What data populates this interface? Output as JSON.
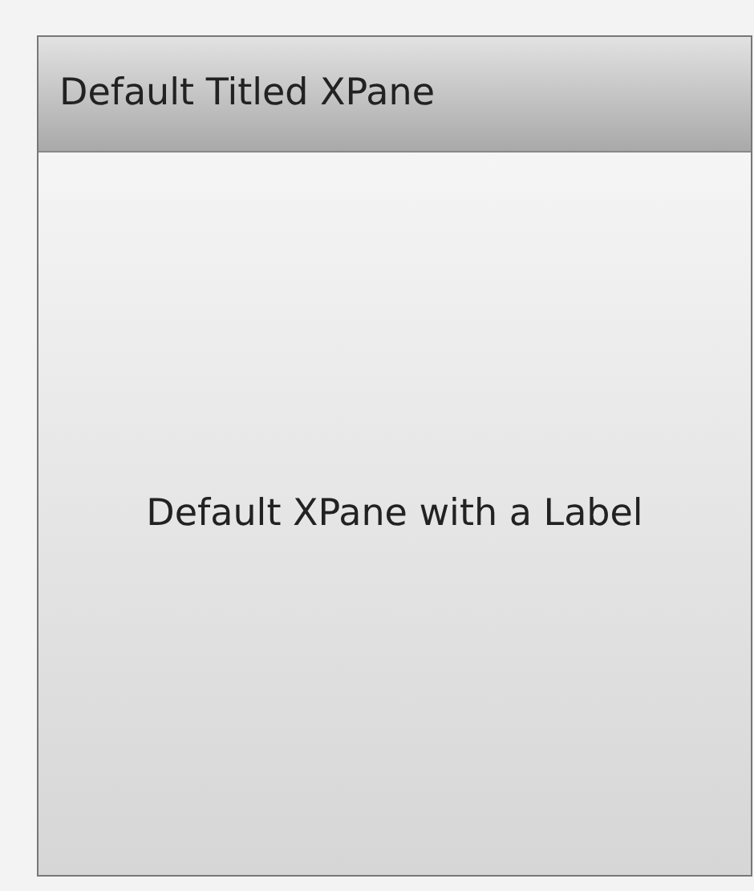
{
  "pane": {
    "title": "Default Titled XPane",
    "label": "Default XPane with a Label"
  }
}
